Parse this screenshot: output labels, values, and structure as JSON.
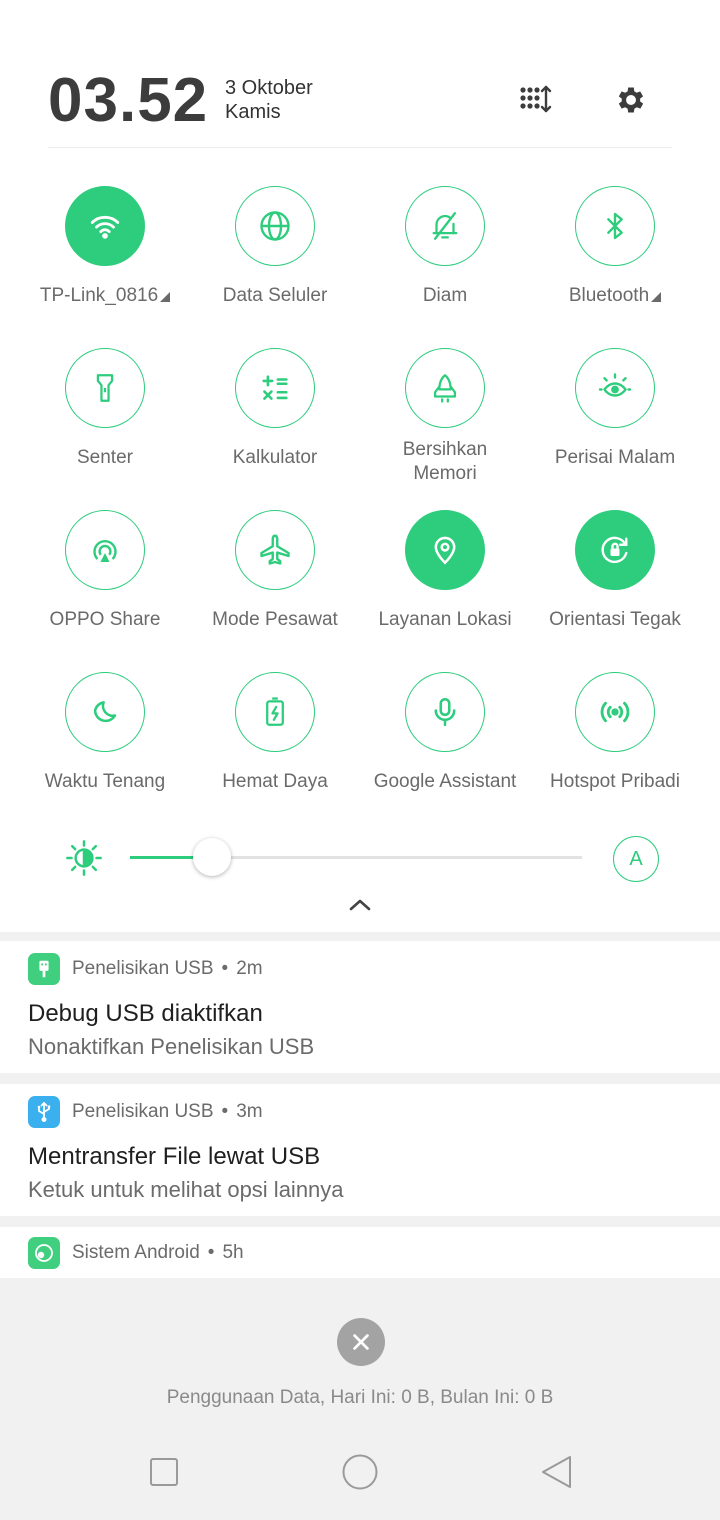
{
  "header": {
    "time": "03.52",
    "date": "3 Oktober",
    "day": "Kamis",
    "edit_icon": "grid-sort-icon",
    "settings_icon": "gear-icon"
  },
  "tiles": [
    {
      "label": "TP-Link_0816",
      "icon": "wifi-icon",
      "active": true,
      "has_more": true
    },
    {
      "label": "Data Seluler",
      "icon": "globe-icon",
      "active": false,
      "has_more": false
    },
    {
      "label": "Diam",
      "icon": "bell-off-icon",
      "active": false,
      "has_more": false
    },
    {
      "label": "Bluetooth",
      "icon": "bluetooth-icon",
      "active": false,
      "has_more": true
    },
    {
      "label": "Senter",
      "icon": "flashlight-icon",
      "active": false
    },
    {
      "label": "Kalkulator",
      "icon": "calculator-icon",
      "active": false
    },
    {
      "label": "Bersihkan Memori",
      "icon": "rocket-icon",
      "active": false
    },
    {
      "label": "Perisai Malam",
      "icon": "eye-shield-icon",
      "active": false
    },
    {
      "label": "OPPO Share",
      "icon": "share-icon",
      "active": false
    },
    {
      "label": "Mode Pesawat",
      "icon": "airplane-icon",
      "active": false
    },
    {
      "label": "Layanan Lokasi",
      "icon": "location-pin-icon",
      "active": true
    },
    {
      "label": "Orientasi Tegak",
      "icon": "rotation-lock-icon",
      "active": true
    },
    {
      "label": "Waktu Tenang",
      "icon": "moon-icon",
      "active": false
    },
    {
      "label": "Hemat Daya",
      "icon": "battery-saver-icon",
      "active": false
    },
    {
      "label": "Google Assistant",
      "icon": "microphone-icon",
      "active": false
    },
    {
      "label": "Hotspot Pribadi",
      "icon": "hotspot-icon",
      "active": false
    }
  ],
  "brightness": {
    "level": 0.14,
    "auto_label": "A"
  },
  "notifications": [
    {
      "app": "Penelisikan USB",
      "dot": "•",
      "time": "2m",
      "title": "Debug USB diaktifkan",
      "text": "Nonaktifkan Penelisikan USB",
      "icon_color": "#3fcf7f",
      "icon": "usb-debug-icon"
    },
    {
      "app": "Penelisikan USB",
      "dot": "•",
      "time": "3m",
      "title": "Mentransfer File lewat USB",
      "text": "Ketuk untuk melihat opsi lainnya",
      "icon_color": "#3bb0ef",
      "icon": "usb-icon"
    },
    {
      "app": "Sistem Android",
      "dot": "•",
      "time": "5h",
      "icon_color": "#3fcf7f",
      "icon": "android-system-icon"
    }
  ],
  "usage_text": "Penggunaan Data, Hari Ini: 0 B, Bulan Ini: 0 B",
  "colors": {
    "accent": "#2ecc7d",
    "panel": "#ffffff",
    "shade": "#f1f1f1"
  }
}
